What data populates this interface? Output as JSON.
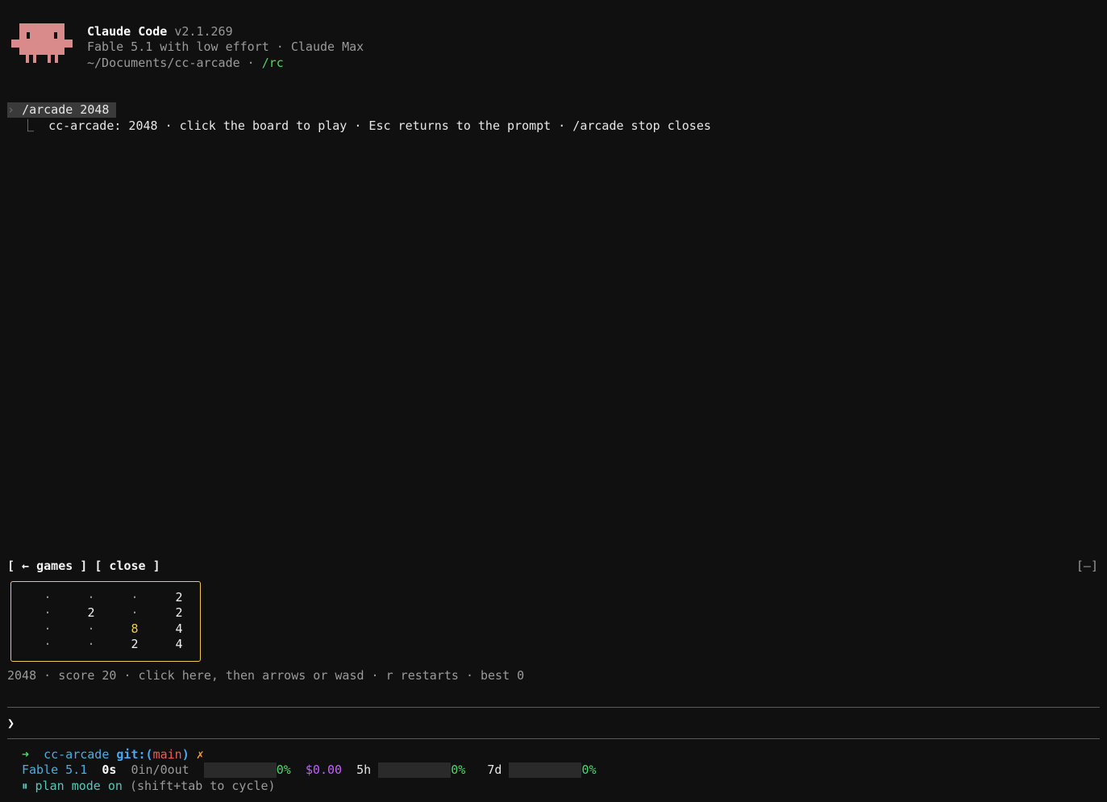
{
  "header": {
    "app_name": "Claude Code",
    "version": "v2.1.269",
    "model_line": "Fable 5.1 with low effort · Claude Max",
    "path": "~/Documents/cc-arcade",
    "path_sep": " · ",
    "remote": "/rc",
    "mascot_color": "#d98a8a"
  },
  "transcript": {
    "command_chevron": "›",
    "command": "/arcade 2048",
    "result_prefix": "⎿",
    "result": "cc-arcade: 2048 · click the board to play · Esc returns to the prompt · /arcade stop closes"
  },
  "game": {
    "toolbar": {
      "games_label": "[ ← games ]",
      "close_label": "[ close ]",
      "minimize_label": "[–]"
    },
    "board": [
      [
        "·",
        "·",
        "·",
        "2"
      ],
      [
        "·",
        "2",
        "·",
        "2"
      ],
      [
        "·",
        "·",
        "8",
        "4"
      ],
      [
        "·",
        "·",
        "2",
        "4"
      ]
    ],
    "status": "2048 · score 20 · click here, then arrows or wasd · r restarts · best 0",
    "accent_color": "#f2c94c"
  },
  "prompt": {
    "caret": "❯",
    "value": ""
  },
  "statusbar": {
    "arrow": "➜",
    "repo": "cc-arcade",
    "git_label": "git:(",
    "branch": "main",
    "git_close": ")",
    "dirty": "✗",
    "model": "Fable 5.1",
    "elapsed": "0s",
    "tokens": "0in/0out",
    "context_pct": "0%",
    "cost": "$0.00",
    "window_5h": "5h",
    "pct_5h": "0%",
    "window_7d": "7d",
    "pct_7d": "0%",
    "mode_icon": "⏸",
    "mode_text": "plan mode on",
    "mode_hint": "(shift+tab to cycle)"
  }
}
